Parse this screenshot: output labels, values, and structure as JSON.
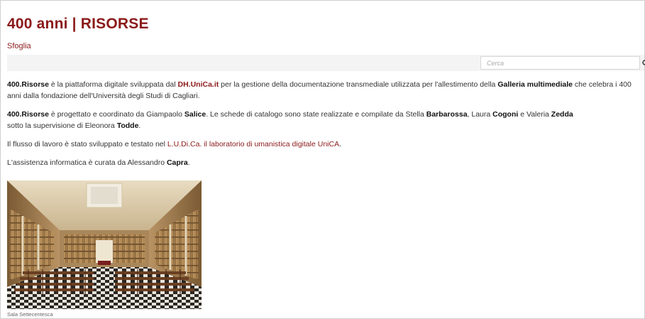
{
  "header": {
    "title": "400 anni | RISORSE",
    "nav_browse": "Sfoglia"
  },
  "search": {
    "placeholder": "Cerca",
    "icon": "search-icon"
  },
  "content": {
    "p1": {
      "s1": "400.Risorse",
      "s2": " è la piattaforma digitale sviluppata dal ",
      "s3": "DH.UniCa.it",
      "s4": " per la gestione della documentazione transmediale utilizzata per l'allestimento della ",
      "s5": "Galleria multimediale",
      "s6": " che celebra i 400 anni dalla fondazione dell'Università degli Studi di Cagliari."
    },
    "p2": {
      "s1": "400.Risorse",
      "s2": " è progettato e coordinato da Giampaolo ",
      "s3": "Salice",
      "s4": ". Le schede di catalogo sono state realizzate e compilate da Stella ",
      "s5": "Barbarossa",
      "s6": ", Laura ",
      "s7": "Cogoni",
      "s8": " e Valeria ",
      "s9": "Zedda",
      "s10": " sotto la supervisione di Eleonora ",
      "s11": "Todde",
      "s12": "."
    },
    "p3": {
      "s1": "Il flusso di lavoro è stato sviluppato e testato nel ",
      "s2": "L.U.Di.Ca. il laboratorio di umanistica digitale UniCA",
      "s3": "."
    },
    "p4": {
      "s1": "L'assistenza informatica è curata da Alessandro ",
      "s2": "Capra",
      "s3": "."
    }
  },
  "image": {
    "caption": "Sala Settecentesca"
  },
  "colors": {
    "accent": "#8b1a1a",
    "search_bar_bg": "#f4f4f4"
  }
}
